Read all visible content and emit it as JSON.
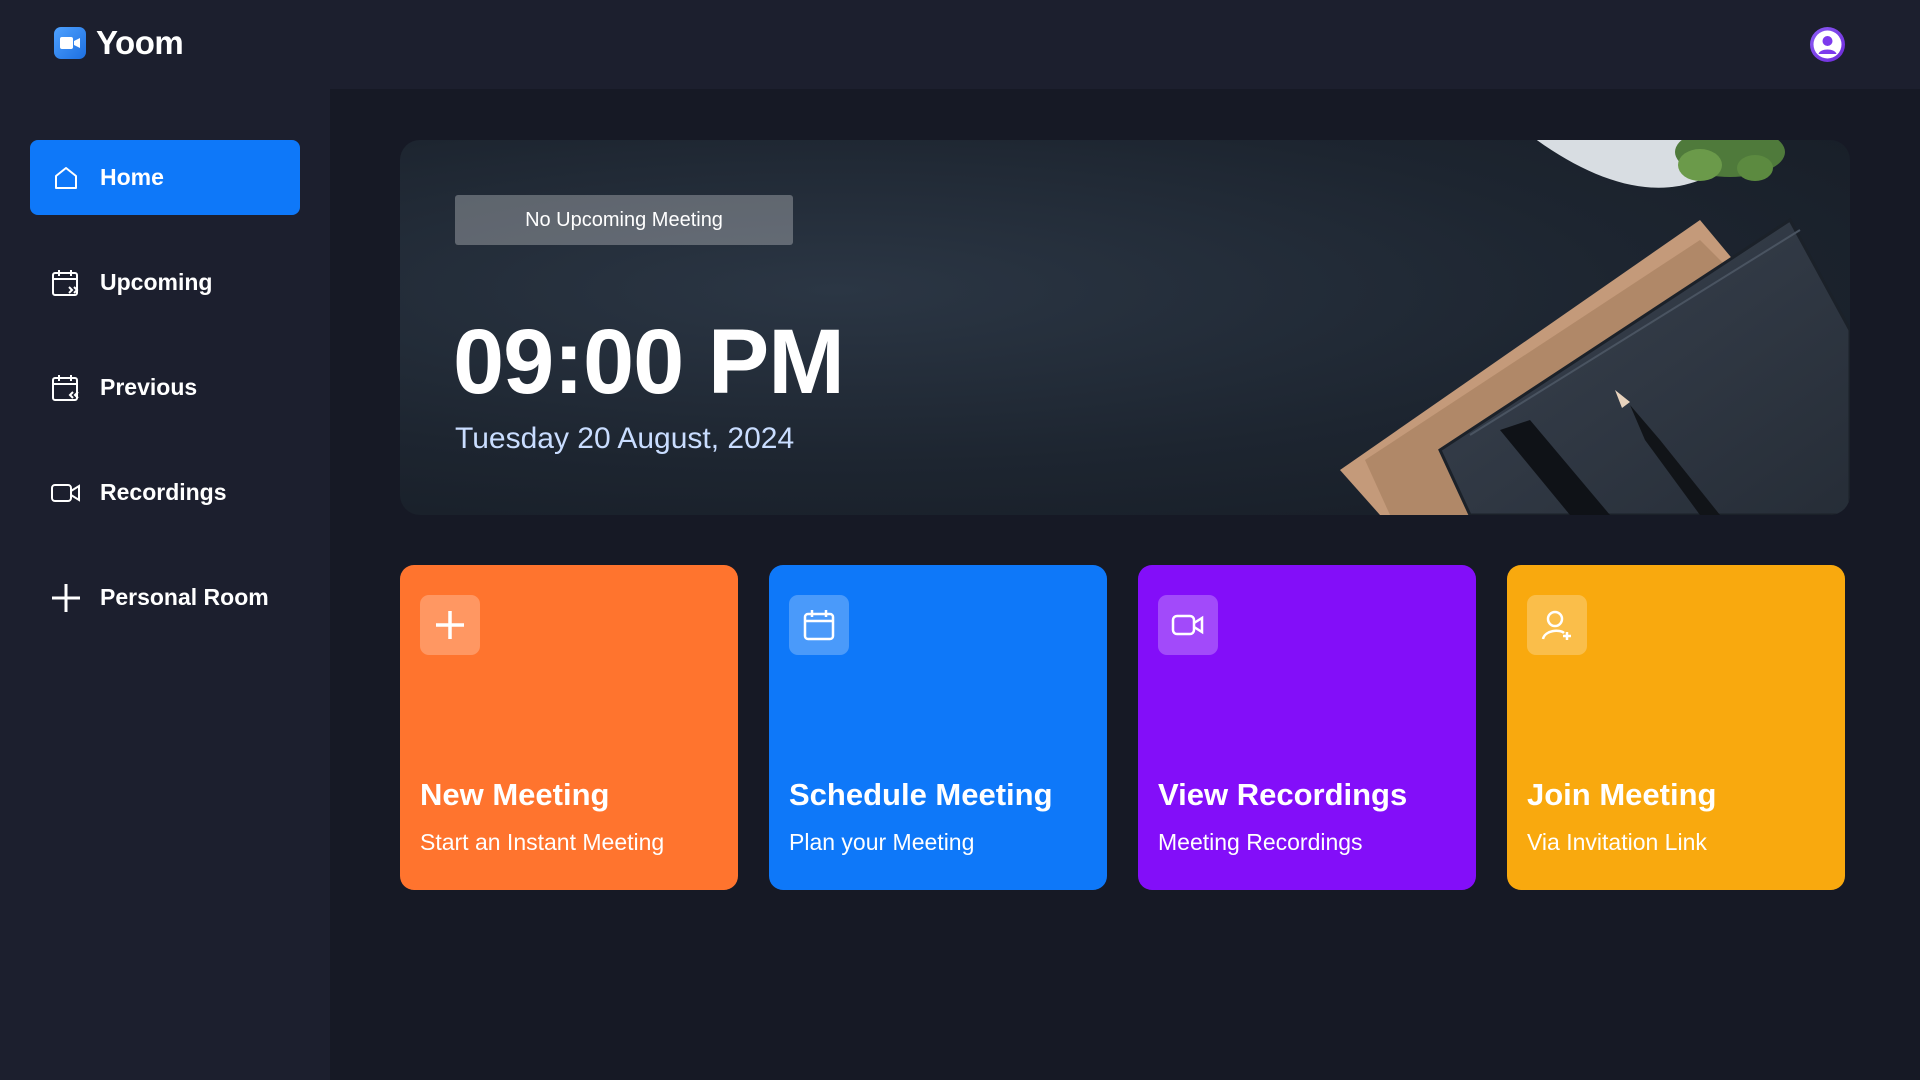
{
  "app": {
    "name": "Yoom",
    "logo_icon": "video-camera-icon",
    "avatar_icon": "user-avatar-icon"
  },
  "sidebar": {
    "items": [
      {
        "label": "Home",
        "icon": "home-icon",
        "active": true
      },
      {
        "label": "Upcoming",
        "icon": "calendar-forward-icon",
        "active": false
      },
      {
        "label": "Previous",
        "icon": "calendar-back-icon",
        "active": false
      },
      {
        "label": "Recordings",
        "icon": "video-icon",
        "active": false
      },
      {
        "label": "Personal Room",
        "icon": "plus-icon",
        "active": false
      }
    ]
  },
  "hero": {
    "badge": "No Upcoming Meeting",
    "time": "09:00 PM",
    "date": "Tuesday 20 August, 2024"
  },
  "cards": [
    {
      "title": "New Meeting",
      "subtitle": "Start an Instant Meeting",
      "icon": "plus-icon",
      "color": "#ff742e"
    },
    {
      "title": "Schedule Meeting",
      "subtitle": "Plan your Meeting",
      "icon": "calendar-icon",
      "color": "#0e78f9"
    },
    {
      "title": "View Recordings",
      "subtitle": "Meeting Recordings",
      "icon": "video-icon",
      "color": "#830ef9"
    },
    {
      "title": "Join Meeting",
      "subtitle": "Via Invitation Link",
      "icon": "user-add-icon",
      "color": "#f9a90e"
    }
  ],
  "colors": {
    "background": "#161925",
    "panel": "#1c1f2e",
    "accent": "#0e78f9"
  }
}
